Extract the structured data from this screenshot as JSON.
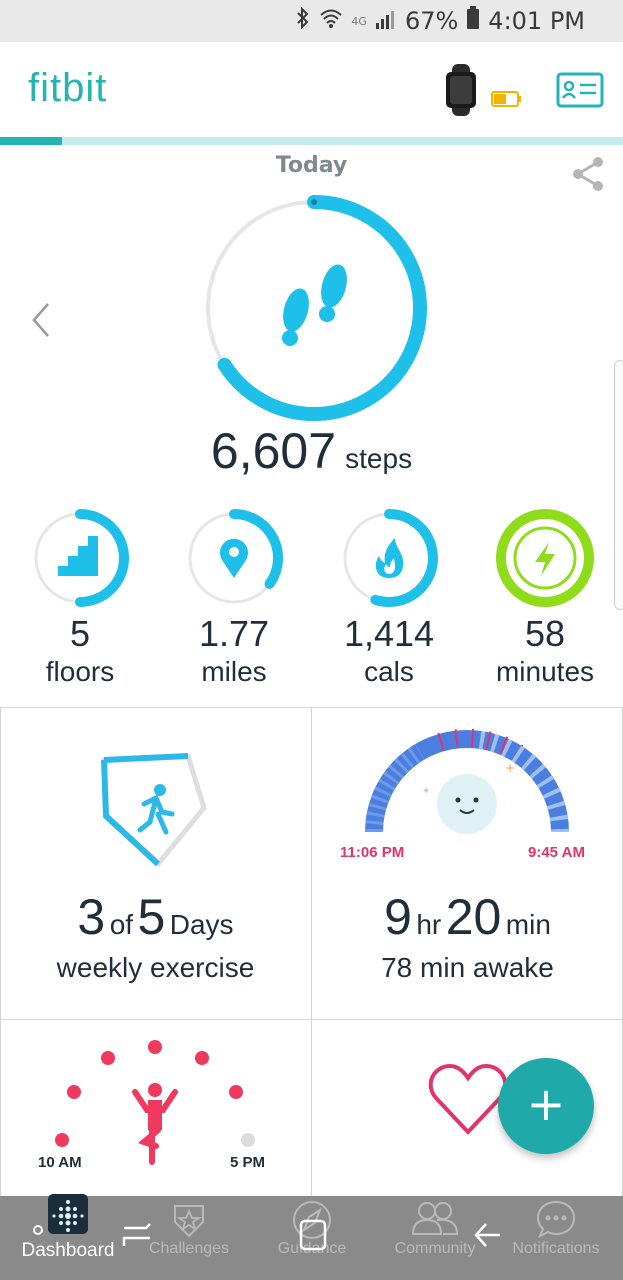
{
  "status_bar": {
    "network": "4G",
    "battery": "67%",
    "time": "4:01 PM"
  },
  "header": {
    "brand": "fitbit",
    "sync_progress": 0.1
  },
  "today": {
    "label": "Today",
    "steps_value": "6,607",
    "steps_unit": "steps",
    "steps_goal_fraction": 0.66
  },
  "stats": [
    {
      "value": "5",
      "unit": "floors",
      "fraction": 0.5,
      "color": "#1ebfe8",
      "icon": "stairs-icon"
    },
    {
      "value": "1.77",
      "unit": "miles",
      "fraction": 0.35,
      "color": "#1ebfe8",
      "icon": "location-pin-icon"
    },
    {
      "value": "1,414",
      "unit": "cals",
      "fraction": 0.55,
      "color": "#1ebfe8",
      "icon": "flame-icon"
    },
    {
      "value": "58",
      "unit": "minutes",
      "fraction": 1.0,
      "color": "#8fdc1a",
      "icon": "lightning-icon"
    }
  ],
  "exercise_tile": {
    "count": "3",
    "of_word": "of",
    "goal": "5",
    "days_word": "Days",
    "subtitle": "weekly exercise"
  },
  "sleep_tile": {
    "start_time": "11:06 PM",
    "end_time": "9:45 AM",
    "hours": "9",
    "hr_word": "hr",
    "minutes": "20",
    "min_word": "min",
    "subtitle": "78 min awake"
  },
  "hourly_tile": {
    "start_label": "10 AM",
    "end_label": "5 PM"
  },
  "fab": {
    "label": "+"
  },
  "bottom_nav": {
    "items": [
      {
        "label": "Dashboard",
        "active": true
      },
      {
        "label": "Challenges",
        "active": false
      },
      {
        "label": "Guidance",
        "active": false
      },
      {
        "label": "Community",
        "active": false
      },
      {
        "label": "Notifications",
        "active": false
      }
    ]
  },
  "colors": {
    "brand_teal": "#25b4b4",
    "steps_blue": "#1ebfe8",
    "active_green": "#8fdc1a",
    "sleep_pink": "#e2336b",
    "hourly_red": "#f0395e"
  }
}
